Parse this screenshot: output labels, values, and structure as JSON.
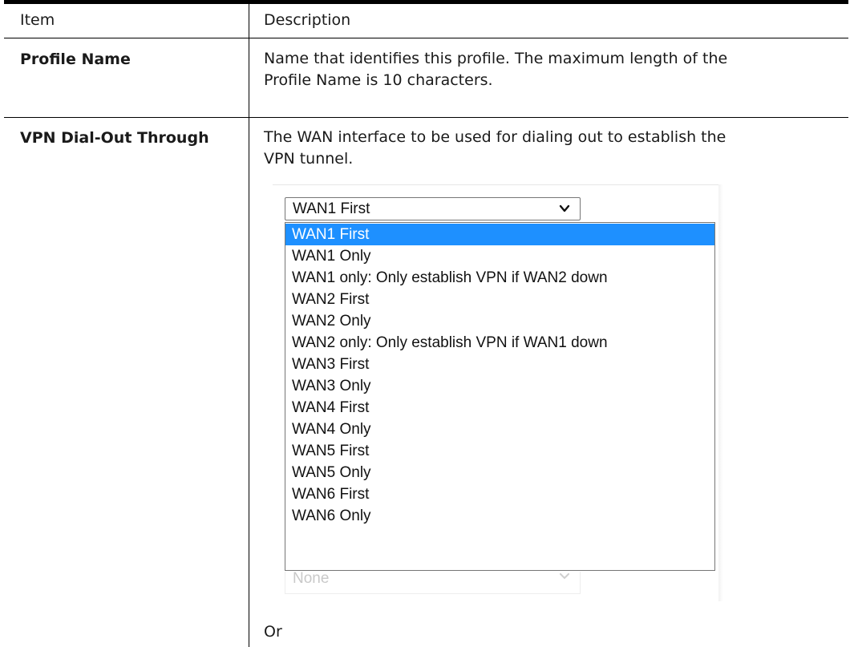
{
  "table": {
    "headers": {
      "item": "Item",
      "description": "Description"
    },
    "rows": [
      {
        "item": "Profile Name",
        "desc_line1": "Name that identifies this profile. The maximum length of the",
        "desc_line2": "Profile Name is 10 characters."
      },
      {
        "item": "VPN Dial-Out Through",
        "desc_line1": "The WAN interface to be used for dialing out to establish the",
        "desc_line2": "VPN tunnel.",
        "trailing": "Or"
      }
    ]
  },
  "dropdown": {
    "selected_value": "WAN1 First",
    "ghost_value": "None",
    "options": [
      "WAN1 First",
      "WAN1 Only",
      "WAN1 only: Only establish VPN if WAN2 down",
      "WAN2 First",
      "WAN2 Only",
      "WAN2 only: Only establish VPN if WAN1 down",
      "WAN3 First",
      "WAN3 Only",
      "WAN4 First",
      "WAN4 Only",
      "WAN5 First",
      "WAN5 Only",
      "WAN6 First",
      "WAN6 Only"
    ],
    "highlight_color": "#1e90ff"
  }
}
